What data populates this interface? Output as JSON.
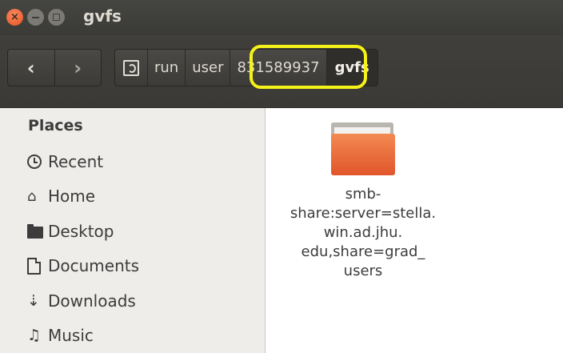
{
  "window": {
    "title": "gvfs",
    "buttons": {
      "close": "×"
    }
  },
  "toolbar": {
    "back_icon": "chevron-left-icon",
    "forward_icon": "chevron-right-icon",
    "back_glyph": "‹",
    "forward_glyph": "›",
    "path": [
      {
        "icon": "drive-icon"
      },
      {
        "label": "run"
      },
      {
        "label": "user"
      },
      {
        "label": "831589937"
      },
      {
        "label": "gvfs",
        "active": true
      }
    ]
  },
  "sidebar": {
    "heading": "Places",
    "items": [
      {
        "label": "Recent",
        "icon": "recent-clock-icon"
      },
      {
        "label": "Home",
        "icon": "home-icon",
        "glyph": "🏠"
      },
      {
        "label": "Desktop",
        "icon": "desktop-folder-icon"
      },
      {
        "label": "Documents",
        "icon": "document-icon"
      },
      {
        "label": "Downloads",
        "icon": "download-icon",
        "glyph": "⇣"
      },
      {
        "label": "Music",
        "icon": "music-icon",
        "glyph": "♫"
      }
    ]
  },
  "main": {
    "files": [
      {
        "name_lines": [
          "smb-",
          "share:server=stella.",
          "win.ad.jhu.",
          "edu,share=grad_",
          "users"
        ],
        "icon": "folder-icon"
      }
    ]
  },
  "colors": {
    "highlight": "#f5f21a",
    "folder_orange": "#e0562a",
    "titlebar": "#3a3a37"
  }
}
